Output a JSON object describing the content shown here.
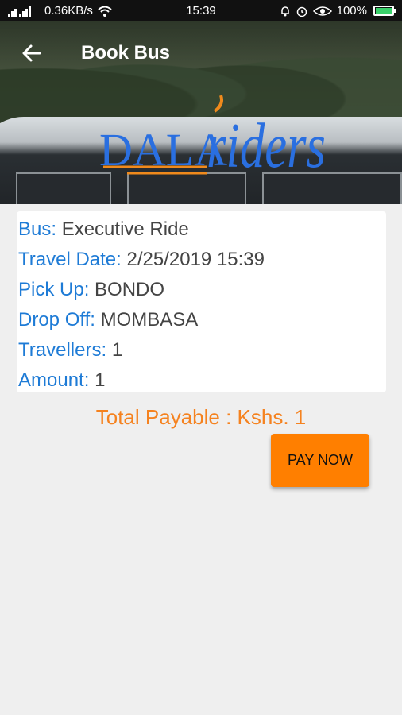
{
  "status_bar": {
    "speed": "0.36KB/s",
    "time": "15:39",
    "battery": "100%"
  },
  "toolbar": {
    "title": "Book Bus"
  },
  "logo": {
    "part1": "DALA",
    "part2": "riders"
  },
  "details": {
    "bus_label": "Bus:",
    "bus_value": "Executive Ride",
    "date_label": "Travel Date:",
    "date_value": "2/25/2019 15:39",
    "pickup_label": "Pick Up:",
    "pickup_value": "BONDO",
    "dropoff_label": "Drop Off:",
    "dropoff_value": "MOMBASA",
    "travellers_label": "Travellers:",
    "travellers_value": "1",
    "amount_label": "Amount:",
    "amount_value": "1"
  },
  "total": "Total Payable : Kshs. 1",
  "pay_button": "PAY NOW",
  "colors": {
    "accent": "#ff7f00",
    "label_blue": "#1e7bd6",
    "total_orange": "#f5821f"
  }
}
